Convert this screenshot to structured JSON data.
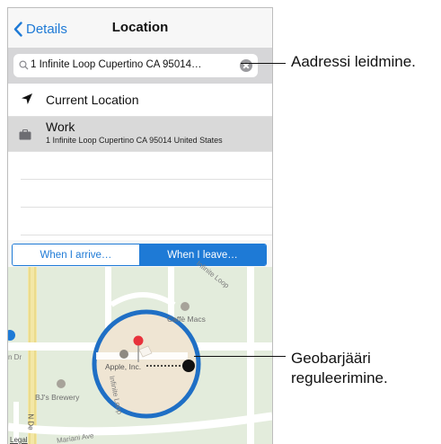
{
  "navbar": {
    "back_label": "Details",
    "title": "Location"
  },
  "search": {
    "value": "1 Infinite Loop Cupertino CA 95014…"
  },
  "list": {
    "current_location": "Current Location",
    "work": {
      "label": "Work",
      "address": "1 Infinite Loop Cupertino CA 95014 United States"
    }
  },
  "segments": {
    "arrive": "When I arrive…",
    "leave": "When I leave…",
    "selected": "leave"
  },
  "map_labels": {
    "infinite_loop_top": "Infinite Loop",
    "caffe_macs": "Caffè Macs",
    "apple_inc": "Apple, Inc.",
    "infinite_loop_left": "Infinite Loop",
    "bjs_brewery": "BJ's Brewery",
    "mariani_ave": "Mariani Ave",
    "n_de": "N De",
    "legal": "Legal",
    "n_dr": "n Dr"
  },
  "callouts": {
    "search": "Aadressi leidmine.",
    "geofence_line1": "Geobarjääri",
    "geofence_line2": "reguleerimine."
  },
  "colors": {
    "accent": "#1e7ad6",
    "selected_row": "#d9d9d9",
    "geofence_ring": "#1f6fc5",
    "pin": "#e8323c"
  }
}
